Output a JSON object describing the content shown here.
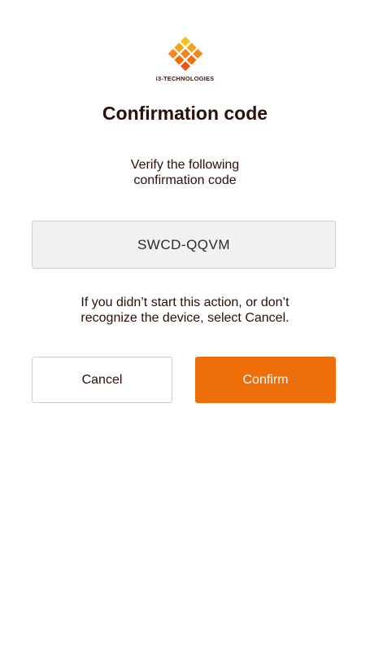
{
  "logo": {
    "text": "i3-TECHNOLOGIES",
    "icon": "i3-diamond-logo",
    "colors": [
      "#f7b21c",
      "#f48a1c",
      "#ee6e0a",
      "#e8541a"
    ]
  },
  "title": "Confirmation code",
  "subtitle": {
    "line1": "Verify the following",
    "line2": "confirmation code"
  },
  "code": "SWCD-QQVM",
  "notice": {
    "line1": "If you didn’t start this action, or don’t",
    "line2": "recognize the device, select Cancel."
  },
  "buttons": {
    "cancel_label": "Cancel",
    "confirm_label": "Confirm"
  },
  "colors": {
    "accent": "#ee6e0a",
    "text": "#2a0f0a",
    "code_background": "#f0f1f3",
    "border": "#c9ccd1"
  }
}
